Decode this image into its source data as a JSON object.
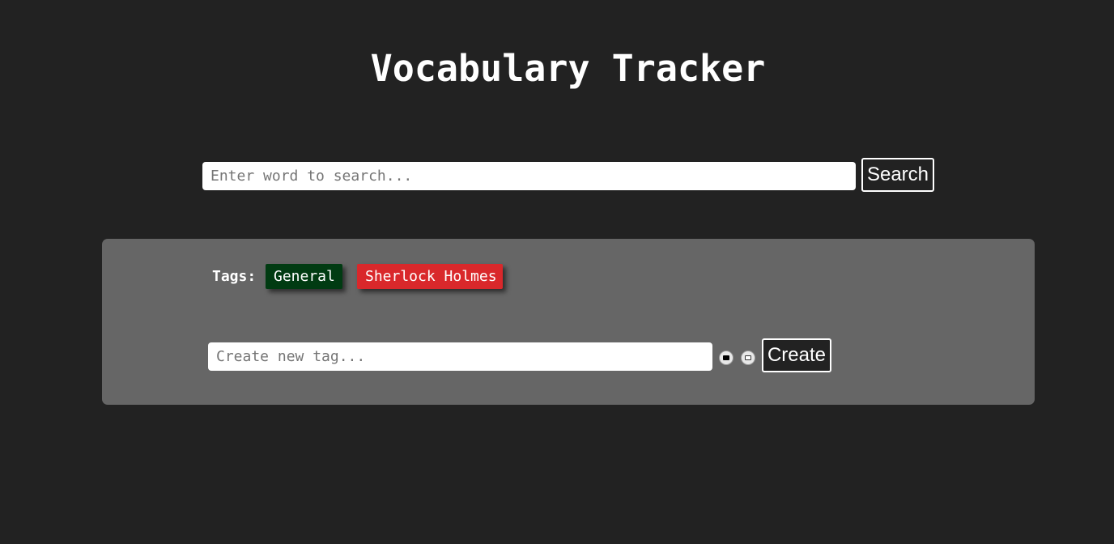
{
  "header": {
    "title": "Vocabulary Tracker"
  },
  "search": {
    "placeholder": "Enter word to search...",
    "value": "",
    "button_label": "Search"
  },
  "tags_panel": {
    "label": "Tags:",
    "tags": [
      {
        "label": "General",
        "color": "#013b12"
      },
      {
        "label": "Sherlock Holmes",
        "color": "#d9282b"
      }
    ],
    "new_tag": {
      "placeholder": "Create new tag...",
      "value": "",
      "color_options": [
        {
          "name": "black-color-option",
          "color": "#000000"
        },
        {
          "name": "white-color-option",
          "color": "#ffffff"
        }
      ],
      "button_label": "Create"
    }
  },
  "colors": {
    "background": "#222222",
    "panel": "#666666",
    "text": "#ffffff"
  }
}
